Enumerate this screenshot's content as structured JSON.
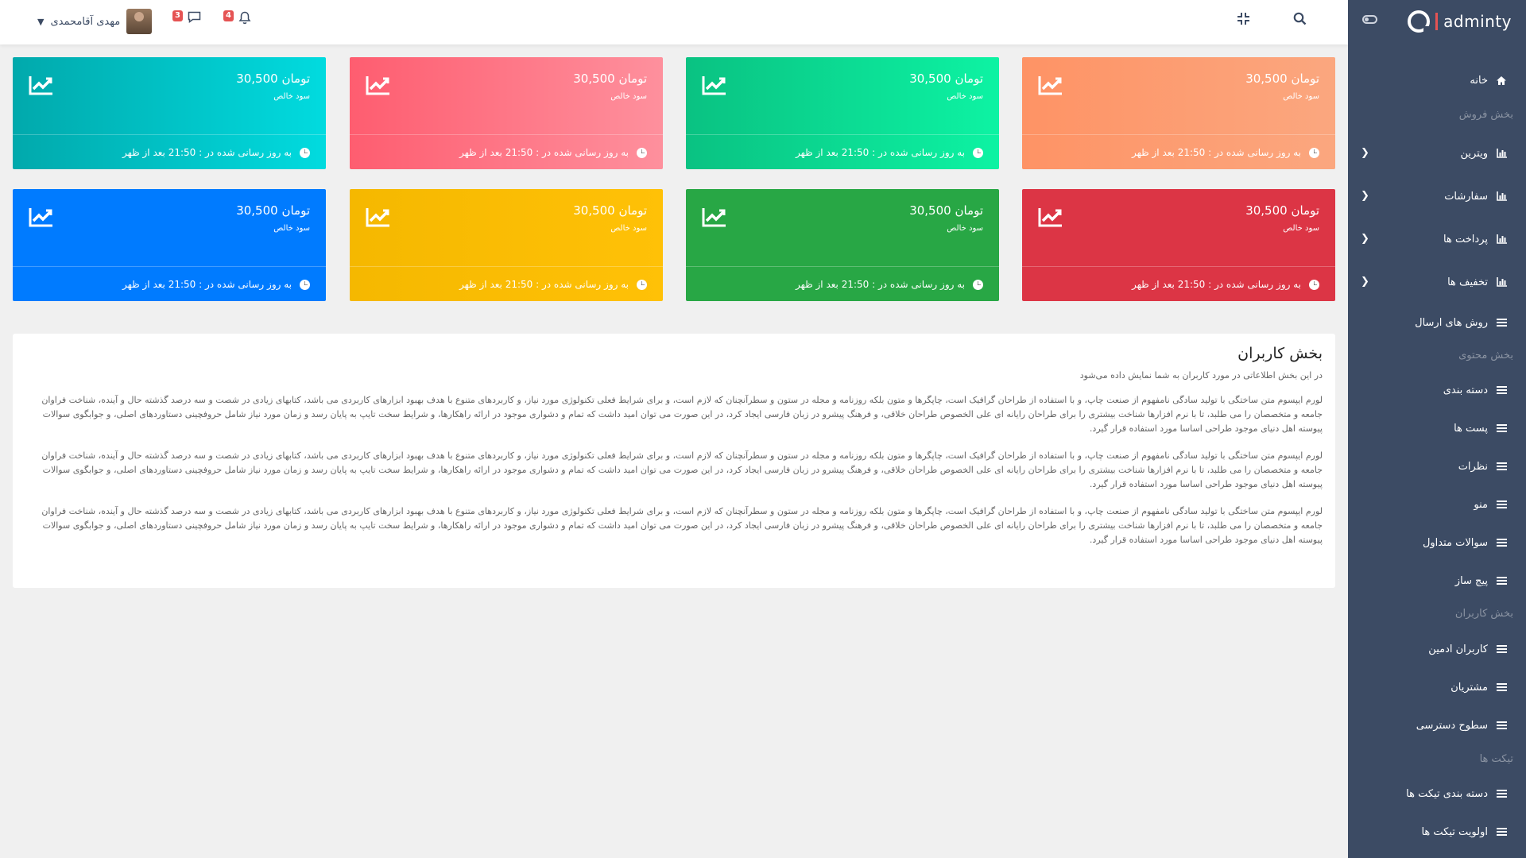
{
  "brand": {
    "name": "adminty"
  },
  "header": {
    "user_name": "مهدی آقامحمدی",
    "messages_count": "3",
    "notifications_count": "4"
  },
  "sidebar": {
    "items": [
      {
        "type": "item",
        "label": "خانه",
        "icon": "home-icon",
        "chevron": false
      },
      {
        "type": "title",
        "label": "بخش فروش"
      },
      {
        "type": "item",
        "label": "ویترین",
        "icon": "bar-chart-icon",
        "chevron": true
      },
      {
        "type": "item",
        "label": "سفارشات",
        "icon": "bar-chart-icon",
        "chevron": true
      },
      {
        "type": "item",
        "label": "پرداخت ها",
        "icon": "bar-chart-icon",
        "chevron": true
      },
      {
        "type": "item",
        "label": "تخفیف ها",
        "icon": "bar-chart-icon",
        "chevron": true
      },
      {
        "type": "item",
        "label": "روش های ارسال",
        "icon": "bars-icon",
        "chevron": false
      },
      {
        "type": "title",
        "label": "بخش محتوی"
      },
      {
        "type": "item",
        "label": "دسته بندی",
        "icon": "bars-icon",
        "chevron": false
      },
      {
        "type": "item",
        "label": "پست ها",
        "icon": "bars-icon",
        "chevron": false
      },
      {
        "type": "item",
        "label": "نظرات",
        "icon": "bars-icon",
        "chevron": false
      },
      {
        "type": "item",
        "label": "منو",
        "icon": "bars-icon",
        "chevron": false
      },
      {
        "type": "item",
        "label": "سوالات متداول",
        "icon": "bars-icon",
        "chevron": false
      },
      {
        "type": "item",
        "label": "پیج ساز",
        "icon": "bars-icon",
        "chevron": false
      },
      {
        "type": "title",
        "label": "بخش کاربران"
      },
      {
        "type": "item",
        "label": "کاربران ادمین",
        "icon": "bars-icon",
        "chevron": false
      },
      {
        "type": "item",
        "label": "مشتریان",
        "icon": "bars-icon",
        "chevron": false
      },
      {
        "type": "item",
        "label": "سطوح دسترسی",
        "icon": "bars-icon",
        "chevron": false
      },
      {
        "type": "title",
        "label": "تیکت ها"
      },
      {
        "type": "item",
        "label": "دسته بندی تیکت ها",
        "icon": "bars-icon",
        "chevron": false
      },
      {
        "type": "item",
        "label": "اولویت تیکت ها",
        "icon": "bars-icon",
        "chevron": false
      }
    ]
  },
  "cards": [
    {
      "value": "30,500 تومان",
      "label": "سود خالص",
      "footer": "به روز رسانی شده در : 21:50 بعد از ظهر",
      "colors": [
        "#fba77f",
        "#fe9365"
      ]
    },
    {
      "value": "30,500 تومان",
      "label": "سود خالص",
      "footer": "به روز رسانی شده در : 21:50 بعد از ظهر",
      "colors": [
        "#0df3a3",
        "#0ac282"
      ]
    },
    {
      "value": "30,500 تومان",
      "label": "سود خالص",
      "footer": "به روز رسانی شده در : 21:50 بعد از ظهر",
      "colors": [
        "#fe909d",
        "#fe5d70"
      ]
    },
    {
      "value": "30,500 تومان",
      "label": "سود خالص",
      "footer": "به روز رسانی شده در : 21:50 بعد از ظهر",
      "colors": [
        "#01dbdf",
        "#01a9ac"
      ]
    },
    {
      "value": "30,500 تومان",
      "label": "سود خالص",
      "footer": "به روز رسانی شده در : 21:50 بعد از ظهر",
      "colors": [
        "#dc3545",
        "#dc3545"
      ]
    },
    {
      "value": "30,500 تومان",
      "label": "سود خالص",
      "footer": "به روز رسانی شده در : 21:50 بعد از ظهر",
      "colors": [
        "#28a745",
        "#28a745"
      ]
    },
    {
      "value": "30,500 تومان",
      "label": "سود خالص",
      "footer": "به روز رسانی شده در : 21:50 بعد از ظهر",
      "colors": [
        "#ffc107",
        "#f5b800"
      ]
    },
    {
      "value": "30,500 تومان",
      "label": "سود خالص",
      "footer": "به روز رسانی شده در : 21:50 بعد از ظهر",
      "colors": [
        "#007bff",
        "#007bff"
      ]
    }
  ],
  "content": {
    "title": "بخش کاربران",
    "subtitle": "در این بخش اطلاعاتی در مورد کاربران به شما نمایش داده می‌شود",
    "paragraphs": [
      "لورم ایپسوم متن ساختگی با تولید سادگی نامفهوم از صنعت چاپ، و با استفاده از طراحان گرافیک است، چاپگرها و متون بلکه روزنامه و مجله در ستون و سطرآنچنان که لازم است، و برای شرایط فعلی تکنولوژی مورد نیاز، و کاربردهای متنوع با هدف بهبود ابزارهای کاربردی می باشد، کتابهای زیادی در شصت و سه درصد گذشته حال و آینده، شناخت فراوان جامعه و متخصصان را می طلبد، تا با نرم افزارها شناخت بیشتری را برای طراحان رایانه ای علی الخصوص طراحان خلاقی، و فرهنگ پیشرو در زبان فارسی ایجاد کرد، در این صورت می توان امید داشت که تمام و دشواری موجود در ارائه راهکارها، و شرایط سخت تایپ به پایان رسد و زمان مورد نیاز شامل حروفچینی دستاوردهای اصلی، و جوابگوی سوالات پیوسته اهل دنیای موجود طراحی اساسا مورد استفاده قرار گیرد.",
      "لورم ایپسوم متن ساختگی با تولید سادگی نامفهوم از صنعت چاپ، و با استفاده از طراحان گرافیک است، چاپگرها و متون بلکه روزنامه و مجله در ستون و سطرآنچنان که لازم است، و برای شرایط فعلی تکنولوژی مورد نیاز، و کاربردهای متنوع با هدف بهبود ابزارهای کاربردی می باشد، کتابهای زیادی در شصت و سه درصد گذشته حال و آینده، شناخت فراوان جامعه و متخصصان را می طلبد، تا با نرم افزارها شناخت بیشتری را برای طراحان رایانه ای علی الخصوص طراحان خلاقی، و فرهنگ پیشرو در زبان فارسی ایجاد کرد، در این صورت می توان امید داشت که تمام و دشواری موجود در ارائه راهکارها، و شرایط سخت تایپ به پایان رسد و زمان مورد نیاز شامل حروفچینی دستاوردهای اصلی، و جوابگوی سوالات پیوسته اهل دنیای موجود طراحی اساسا مورد استفاده قرار گیرد.",
      "لورم ایپسوم متن ساختگی با تولید سادگی نامفهوم از صنعت چاپ، و با استفاده از طراحان گرافیک است، چاپگرها و متون بلکه روزنامه و مجله در ستون و سطرآنچنان که لازم است، و برای شرایط فعلی تکنولوژی مورد نیاز، و کاربردهای متنوع با هدف بهبود ابزارهای کاربردی می باشد، کتابهای زیادی در شصت و سه درصد گذشته حال و آینده، شناخت فراوان جامعه و متخصصان را می طلبد، تا با نرم افزارها شناخت بیشتری را برای طراحان رایانه ای علی الخصوص طراحان خلاقی، و فرهنگ پیشرو در زبان فارسی ایجاد کرد، در این صورت می توان امید داشت که تمام و دشواری موجود در ارائه راهکارها، و شرایط سخت تایپ به پایان رسد و زمان مورد نیاز شامل حروفچینی دستاوردهای اصلی، و جوابگوی سوالات پیوسته اهل دنیای موجود طراحی اساسا مورد استفاده قرار گیرد."
    ]
  }
}
